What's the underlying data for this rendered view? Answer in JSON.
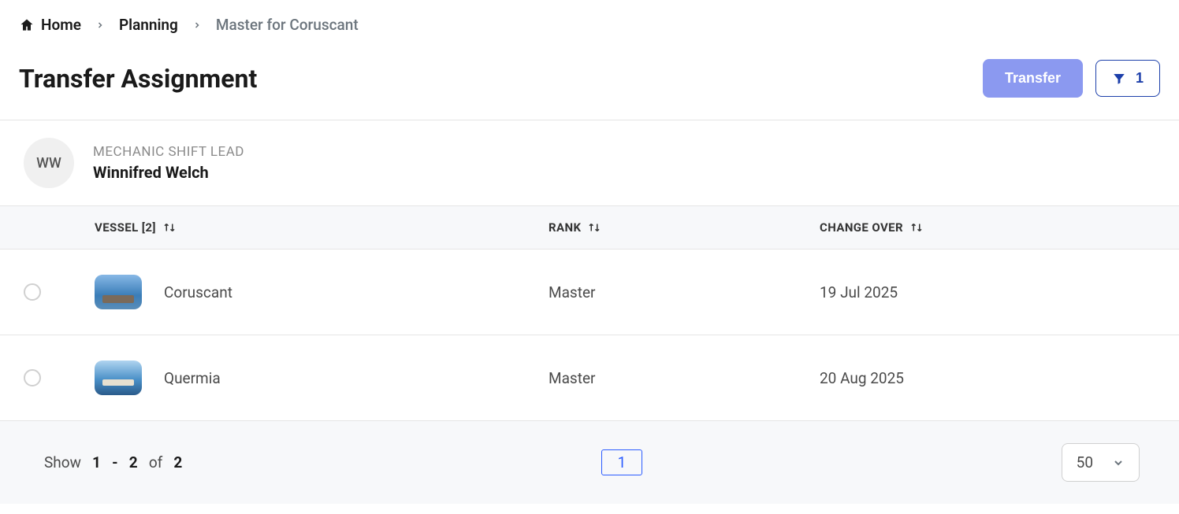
{
  "breadcrumb": {
    "home": "Home",
    "planning": "Planning",
    "current": "Master for Coruscant"
  },
  "page": {
    "title": "Transfer Assignment"
  },
  "actions": {
    "transfer_label": "Transfer",
    "filter_count": "1"
  },
  "person": {
    "initials": "WW",
    "role": "MECHANIC SHIFT LEAD",
    "name": "Winnifred Welch"
  },
  "table": {
    "headers": {
      "vessel": "VESSEL [2]",
      "rank": "RANK",
      "change_over": "CHANGE OVER"
    },
    "rows": [
      {
        "vessel": "Coruscant",
        "rank": "Master",
        "change_over": "19 Jul 2025"
      },
      {
        "vessel": "Quermia",
        "rank": "Master",
        "change_over": "20 Aug 2025"
      }
    ]
  },
  "pagination": {
    "show_prefix": "Show",
    "from": "1",
    "dash": "-",
    "to": "2",
    "of_label": "of",
    "total": "2",
    "current_page": "1",
    "page_size": "50"
  }
}
